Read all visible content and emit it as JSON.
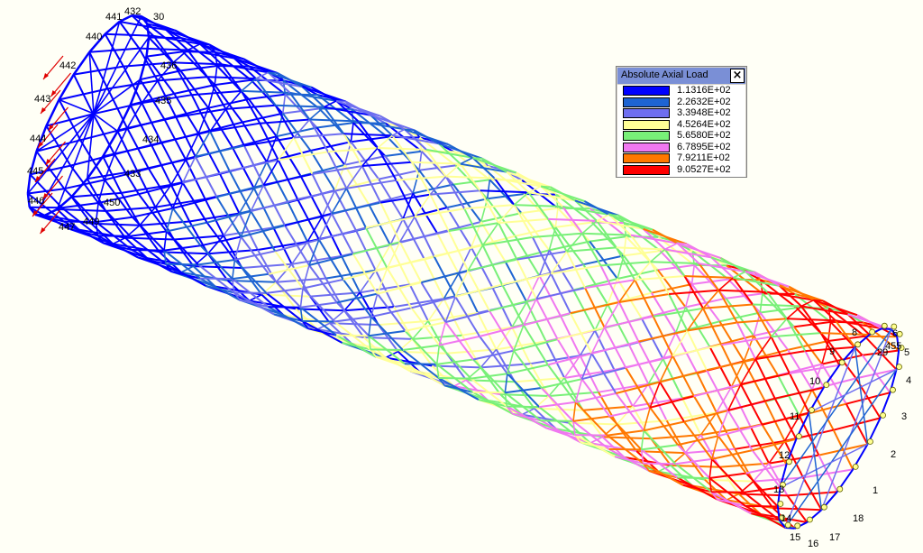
{
  "legend": {
    "title": "Absolute Axial Load",
    "close_icon": "close-icon",
    "entries": [
      {
        "value": "1.1316E+02",
        "color": "#0000ff"
      },
      {
        "value": "2.2632E+02",
        "color": "#1e64d2"
      },
      {
        "value": "3.3948E+02",
        "color": "#6e6ef0"
      },
      {
        "value": "4.5264E+02",
        "color": "#ffff96"
      },
      {
        "value": "5.6580E+02",
        "color": "#78f078"
      },
      {
        "value": "6.7895E+02",
        "color": "#f078f0"
      },
      {
        "value": "7.9211E+02",
        "color": "#ff7800"
      },
      {
        "value": "9.0527E+02",
        "color": "#ff0000"
      }
    ]
  },
  "node_labels": [
    "432",
    "30",
    "440",
    "441",
    "442",
    "436",
    "435",
    "443",
    "434",
    "444",
    "433",
    "445",
    "450",
    "446",
    "447",
    "449",
    "1",
    "2",
    "3",
    "4",
    "5",
    "6",
    "8",
    "9",
    "10",
    "11",
    "12",
    "13",
    "14",
    "15",
    "16",
    "17",
    "18",
    "29",
    "455"
  ],
  "icons": {
    "load_arrow": "red-force-arrow-icon",
    "support": "support-node-icon"
  }
}
